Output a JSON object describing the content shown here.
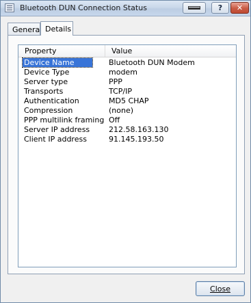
{
  "window": {
    "title": "Bluetooth DUN Connection Status",
    "caption_buttons": {
      "help": "?",
      "close": "✕"
    }
  },
  "tabs": [
    {
      "label": "General",
      "active": false
    },
    {
      "label": "Details",
      "active": true
    }
  ],
  "listview": {
    "columns": [
      "Property",
      "Value"
    ],
    "rows": [
      {
        "property": "Device Name",
        "value": "Bluetooth DUN Modem",
        "selected": true
      },
      {
        "property": "Device Type",
        "value": "modem"
      },
      {
        "property": "Server type",
        "value": "PPP"
      },
      {
        "property": "Transports",
        "value": "TCP/IP"
      },
      {
        "property": "Authentication",
        "value": "MD5 CHAP"
      },
      {
        "property": "Compression",
        "value": "(none)"
      },
      {
        "property": "PPP multilink framing",
        "value": "Off"
      },
      {
        "property": "Server IP address",
        "value": "212.58.163.130"
      },
      {
        "property": "Client IP address",
        "value": "91.145.193.50"
      }
    ]
  },
  "footer": {
    "close_label": "Close"
  }
}
